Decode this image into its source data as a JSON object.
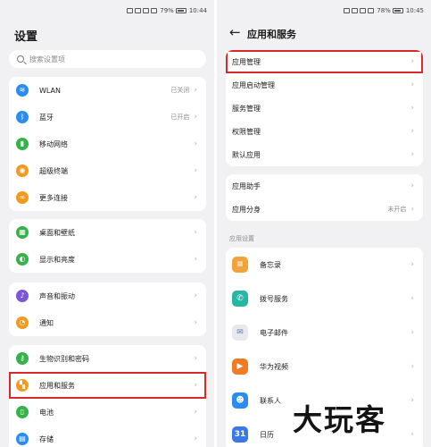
{
  "left": {
    "status": {
      "battery": "79%",
      "time": "10:44"
    },
    "title": "设置",
    "search_placeholder": "搜索设置项",
    "groups": [
      [
        {
          "label": "WLAN",
          "value": "已关闭",
          "icon": "wifi-icon",
          "color": "#2a8cf0"
        },
        {
          "label": "蓝牙",
          "value": "已开启",
          "icon": "bluetooth-icon",
          "color": "#2a8cf0"
        },
        {
          "label": "移动网络",
          "value": "",
          "icon": "signal-icon",
          "color": "#36b24a"
        },
        {
          "label": "超级终端",
          "value": "",
          "icon": "super-device-icon",
          "color": "#f29a20"
        },
        {
          "label": "更多连接",
          "value": "",
          "icon": "link-icon",
          "color": "#f29a20"
        }
      ],
      [
        {
          "label": "桌面和壁纸",
          "value": "",
          "icon": "wallpaper-icon",
          "color": "#36b24a"
        },
        {
          "label": "显示和亮度",
          "value": "",
          "icon": "brightness-icon",
          "color": "#36b24a"
        }
      ],
      [
        {
          "label": "声音和振动",
          "value": "",
          "icon": "sound-icon",
          "color": "#7b56d6"
        },
        {
          "label": "通知",
          "value": "",
          "icon": "bell-icon",
          "color": "#f29a20"
        }
      ],
      [
        {
          "label": "生物识别和密码",
          "value": "",
          "icon": "key-icon",
          "color": "#36b24a"
        },
        {
          "label": "应用和服务",
          "value": "",
          "icon": "apps-icon",
          "color": "#f29a20"
        },
        {
          "label": "电池",
          "value": "",
          "icon": "battery-icon",
          "color": "#36b24a"
        },
        {
          "label": "存储",
          "value": "",
          "icon": "storage-icon",
          "color": "#2a8cf0"
        }
      ]
    ]
  },
  "right": {
    "status": {
      "battery": "78%",
      "time": "10:45"
    },
    "title": "应用和服务",
    "group1": [
      {
        "label": "应用管理",
        "value": ""
      },
      {
        "label": "应用启动管理",
        "value": ""
      },
      {
        "label": "服务管理",
        "value": ""
      },
      {
        "label": "权限管理",
        "value": ""
      },
      {
        "label": "默认应用",
        "value": ""
      }
    ],
    "group2": [
      {
        "label": "应用助手",
        "value": ""
      },
      {
        "label": "应用分身",
        "value": "未开启"
      }
    ],
    "section_label": "应用设置",
    "apps": [
      {
        "label": "备忘录",
        "icon": "memo-icon",
        "color": "#f4a23a",
        "glyph": "≡"
      },
      {
        "label": "拨号服务",
        "icon": "phone-icon",
        "color": "#25b7a2",
        "glyph": "✆"
      },
      {
        "label": "电子邮件",
        "icon": "email-icon",
        "color": "#e8e8ee",
        "glyph": "✉"
      },
      {
        "label": "华为视频",
        "icon": "video-icon",
        "color": "#f27a22",
        "glyph": "▶"
      },
      {
        "label": "联系人",
        "icon": "contacts-icon",
        "color": "#2a8cf0",
        "glyph": "☻"
      },
      {
        "label": "日历",
        "icon": "calendar-icon",
        "color": "#3a78e6",
        "glyph": "31"
      }
    ]
  },
  "watermark": "大玩客"
}
